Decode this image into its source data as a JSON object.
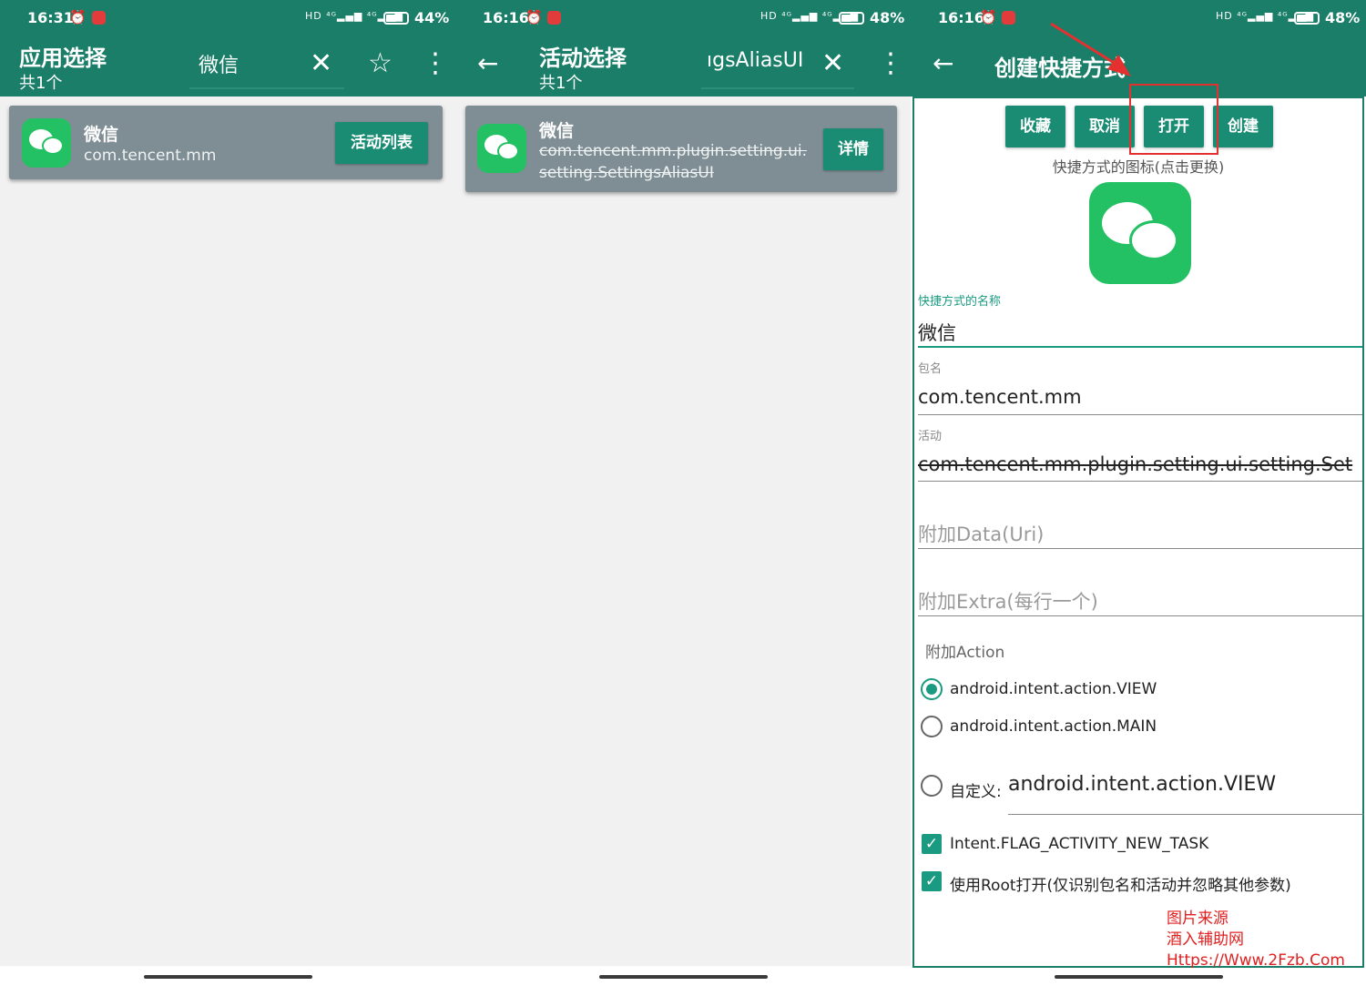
{
  "colors": {
    "toolbar": "#1a7e68",
    "accent": "#1a9a80",
    "card": "#7f8e94",
    "button": "#1a8c74",
    "annotation": "#e53030"
  },
  "panel1": {
    "status": {
      "time": "16:31",
      "battery": "44%"
    },
    "title": "应用选择",
    "count": "共1个",
    "search_value": "微信",
    "icons": [
      "close-icon",
      "star-icon",
      "more-vert-icon"
    ],
    "item": {
      "name": "微信",
      "package": "com.tencent.mm",
      "button": "活动列表"
    }
  },
  "panel2": {
    "status": {
      "time": "16:16",
      "battery": "48%"
    },
    "title": "活动选择",
    "count": "共1个",
    "search_value": "ıgsAliasUI",
    "icons": [
      "back-arrow-icon",
      "close-icon",
      "more-vert-icon"
    ],
    "item": {
      "name": "微信",
      "activity_line1": "com.tencent.mm.plugin.setting.ui.",
      "activity_line2": "setting.SettingsAliasUI",
      "button": "详情"
    }
  },
  "panel3": {
    "status": {
      "time": "16:16",
      "battery": "48%"
    },
    "title": "创建快捷方式",
    "buttons": {
      "favorite": "收藏",
      "cancel": "取消",
      "open": "打开",
      "create": "创建"
    },
    "icon_hint": "快捷方式的图标(点击更换)",
    "name_label": "快捷方式的名称",
    "name_value": "微信",
    "package_label": "包名",
    "package_value": "com.tencent.mm",
    "activity_label": "活动",
    "activity_value": "com.tencent.mm.plugin.setting.ui.setting.Set",
    "data_placeholder": "附加Data(Uri)",
    "extra_placeholder": "附加Extra(每行一个)",
    "action_label": "附加Action",
    "actions": [
      {
        "label": "android.intent.action.VIEW",
        "selected": true
      },
      {
        "label": "android.intent.action.MAIN",
        "selected": false
      }
    ],
    "custom_label": "自定义:",
    "custom_value": "android.intent.action.VIEW",
    "flags": [
      {
        "label": "Intent.FLAG_ACTIVITY_NEW_TASK",
        "checked": true
      },
      {
        "label": "使用Root打开(仅识别包名和活动并忽略其他参数)",
        "checked": true
      }
    ],
    "watermark": {
      "line1": "图片来源",
      "line2": "酒入辅助网",
      "line3": "Https://Www.2Fzb.Com"
    }
  }
}
